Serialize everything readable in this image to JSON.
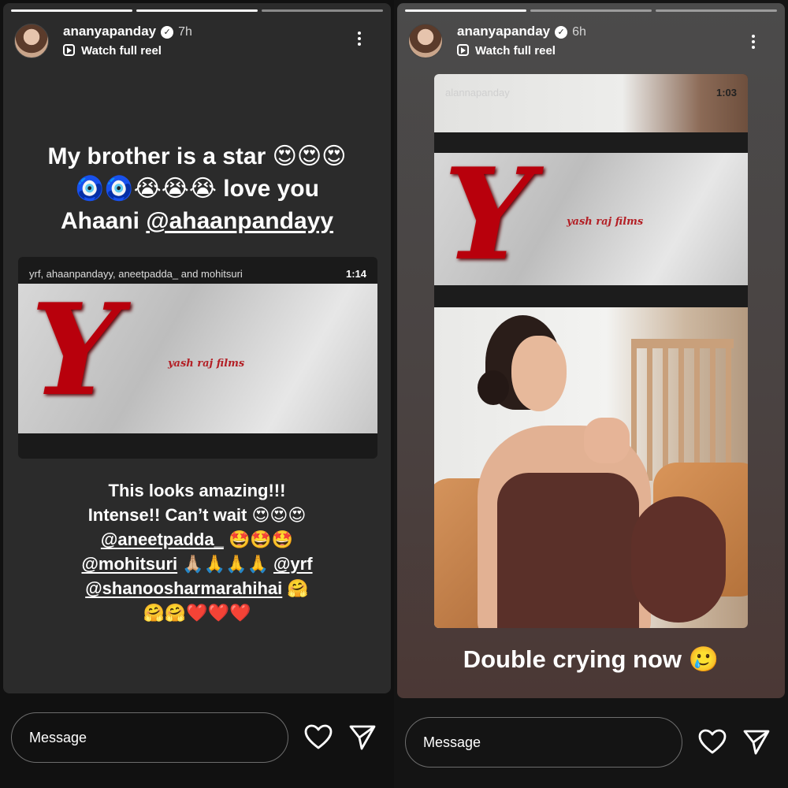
{
  "left": {
    "user": {
      "name": "ananyapanday",
      "time": "7h",
      "watch_label": "Watch full reel"
    },
    "caption_top": {
      "line1": "My brother is a star 😍😍😍",
      "line2": "🧿🧿😭😭😭 love you",
      "line3_text": "Ahaani ",
      "line3_mention": "@ahaanpandayy"
    },
    "video": {
      "credits": "yrf, ahaanpandayy, aneetpadda_ and mohitsuri",
      "duration": "1:14",
      "logo_text": "yash raj films"
    },
    "caption_bottom": {
      "line1": "This looks amazing!!!",
      "line2": "Intense!! Can’t wait 😍😍😍",
      "line3_mention": "@aneetpadda_",
      "line3_emoji": " 🤩🤩🤩",
      "line4_mention1": "@mohitsuri",
      "line4_emoji": " 🙏🏼🙏🙏🙏 ",
      "line4_mention2": "@yrf",
      "line5_mention": "@shanoosharmarahihai",
      "line5_emoji": " 🤗",
      "line6": "🤗🤗❤️❤️❤️"
    },
    "message_placeholder": "Message"
  },
  "right": {
    "user": {
      "name": "ananyapanday",
      "time": "6h",
      "watch_label": "Watch full reel"
    },
    "video": {
      "credits": "alannapanday",
      "duration": "1:03",
      "logo_text": "yash raj films"
    },
    "caption": "Double crying now 🥲",
    "message_placeholder": "Message"
  },
  "icons": {
    "heart": "heart-icon",
    "send": "send-icon",
    "more": "more-options-icon",
    "verified": "verified-badge-icon",
    "reel": "reel-icon"
  },
  "colors": {
    "story_bg_left": "#2b2b2b",
    "yrf_red": "#b8000c"
  }
}
